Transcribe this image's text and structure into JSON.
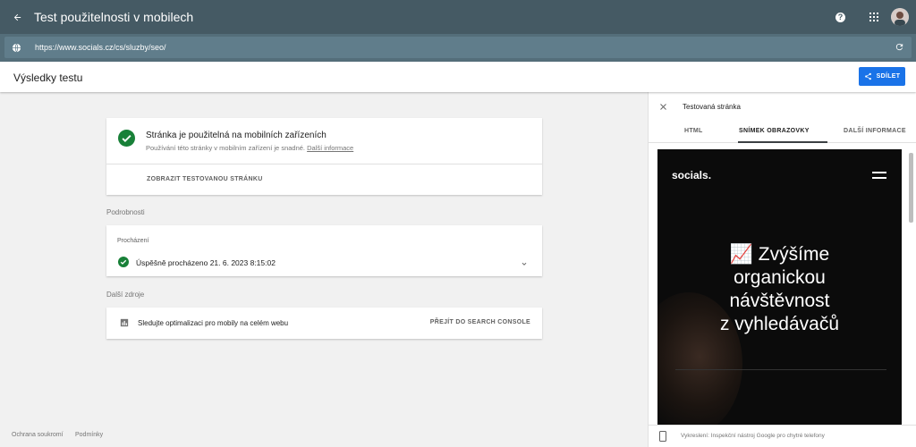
{
  "app": {
    "title": "Test použitelnosti v mobilech"
  },
  "url": {
    "value": "https://www.socials.cz/cs/sluzby/seo/"
  },
  "results": {
    "title": "Výsledky testu",
    "share_label": "SDÍLET"
  },
  "status_card": {
    "headline": "Stránka je použitelná na mobilních zařízeních",
    "subtext": "Používání této stránky v mobilním zařízení je snadné.",
    "link": "Další informace",
    "view_button": "ZOBRAZIT TESTOVANOU STRÁNKU"
  },
  "details": {
    "label": "Podrobnosti",
    "crawl_label": "Procházení",
    "crawl_status": "Úspěšně procházeno 21. 6. 2023 8:15:02"
  },
  "resources": {
    "label": "Další zdroje",
    "text": "Sledujte optimalizaci pro mobily na celém webu",
    "button": "PŘEJÍT DO SEARCH CONSOLE"
  },
  "footer": {
    "privacy": "Ochrana soukromí",
    "terms": "Podmínky"
  },
  "panel": {
    "title": "Testovaná stránka",
    "tabs": [
      "HTML",
      "SNÍMEK OBRAZOVKY",
      "DALŠÍ INFORMACE"
    ],
    "active_tab": "SNÍMEK OBRAZOVKY",
    "screenshot": {
      "logo": "socials.",
      "headline_lines": [
        "📈 Zvýšíme",
        "organickou",
        "návštěvnost",
        "z vyhledávačů"
      ]
    },
    "footer_text": "Vykreslení: Inspekční nástroj Google pro chytré telefony"
  },
  "colors": {
    "header": "#455a64",
    "url_bar": "#546e7a",
    "accent": "#1a73e8",
    "success": "#188038"
  }
}
